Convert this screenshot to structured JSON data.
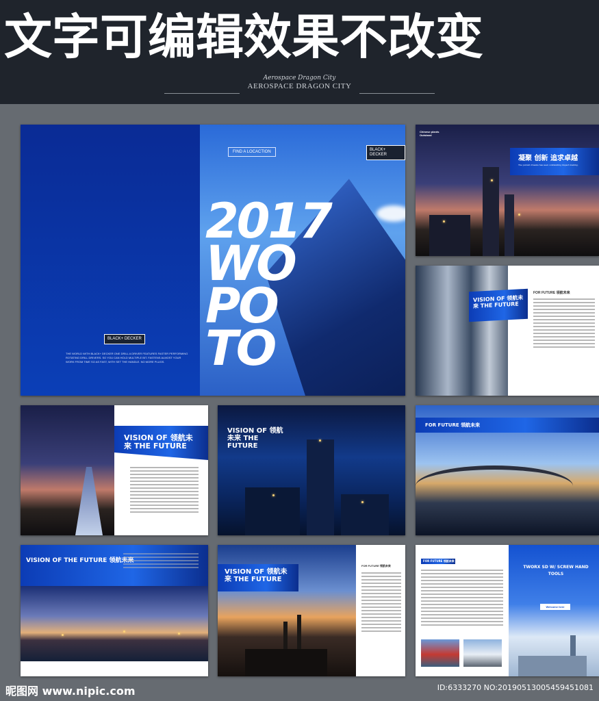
{
  "header": {
    "banner": "文字可编辑效果不改变",
    "logo_script": "Aerospace Dragon City",
    "logo_main": "AEROSPACE DRAGON CITY"
  },
  "cover": {
    "find_button": "FIND A LOCACTION",
    "brand_top": "BLACK+ DECKER",
    "brand_bottom": "BLACK+ DECKER",
    "year_text": "2017 WO PO TO",
    "body_text": "THE WORLD WITH BLACK+ DECKER ONE DRILL A DRIVER FEATURES FASTER PERFORMING ROTATING DRILL DRIVERS. SO YOU CAN HOLD MULTIPLE BIT. FASTENS ALMOST YOUR WORK FROM TIME SO AS FAST, WITH SET THE HANDLE. NO MORE PLUGS."
  },
  "panel_refinery_night": {
    "title": "Chinese plants Outstand",
    "calligraphy": "凝聚 创新 追求卓越",
    "caption": "The pursuit dreams has seen outstanding impact making."
  },
  "panel_vision_a": {
    "ribbon_title": "VISION OF 领航未来 THE FUTURE",
    "heading": "FOR FUTURE 领航未来"
  },
  "panel_vision_b": {
    "ribbon_title": "VISION OF 领航未来 THE FUTURE"
  },
  "panel_vision_c": {
    "ribbon_title": "VISION OF 领航未来 THE FUTURE"
  },
  "panel_bridge": {
    "heading": "FOR FUTURE 领航未来"
  },
  "panel_sea": {
    "ribbon_title": "VISION OF THE FUTURE 领航未来"
  },
  "panel_vision_d": {
    "ribbon_title": "VISION OF 领航未来 THE FUTURE",
    "heading": "FOR FUTURE 领航未来"
  },
  "panel_tools": {
    "tag": "FOR FUTURE 领航未来",
    "title": "TWORX SD W/ SCREW HAND TOOLS",
    "button": "Welcome here"
  },
  "footer": {
    "site": "昵图网 www.nipic.com",
    "id": "ID:6333270 NO:20190513005459451081"
  },
  "colors": {
    "accent_blue": "#1452d1",
    "background": "#5d6268",
    "header_bg": "#1f242c"
  }
}
